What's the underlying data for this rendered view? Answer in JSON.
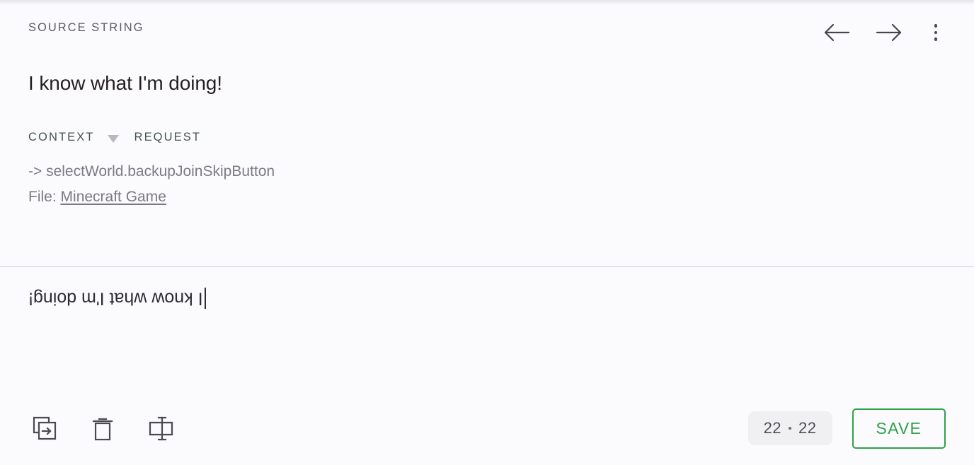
{
  "source": {
    "label": "SOURCE STRING",
    "text": "I know what I'm doing!",
    "nav": {
      "previous_label": "Previous string",
      "previous_icon": "arrow-left-icon",
      "next_label": "Next string",
      "next_icon": "arrow-right-icon",
      "menu_label": "More options",
      "menu_icon": "kebab-menu-icon"
    }
  },
  "context": {
    "tabs": [
      {
        "label": "CONTEXT",
        "active": true
      },
      {
        "label": "REQUEST",
        "active": false
      }
    ],
    "caret_icon": "chevron-down-icon",
    "key_line": "-> selectWorld.backupJoinSkipButton",
    "file_label": "File:",
    "file_link": "Minecraft Game"
  },
  "translation": {
    "text": "I know what I'm doing!",
    "placeholder": "",
    "rotated": true
  },
  "toolbar": {
    "tools": [
      {
        "name": "copy-source-icon",
        "label": "Copy source to translation"
      },
      {
        "name": "trash-icon",
        "label": "Delete translation"
      },
      {
        "name": "split-string-icon",
        "label": "Split string"
      }
    ],
    "counter": {
      "current": "22",
      "separator": "·",
      "total": "22"
    },
    "save_label": "SAVE"
  },
  "colors": {
    "background": "#fbfafd",
    "accent_green": "#2fa14a",
    "tab_green": "#46554c",
    "muted_text": "#7b7b83",
    "source_text": "#241f20",
    "divider": "#d3d3da",
    "pill_background": "#f0f0f2"
  }
}
